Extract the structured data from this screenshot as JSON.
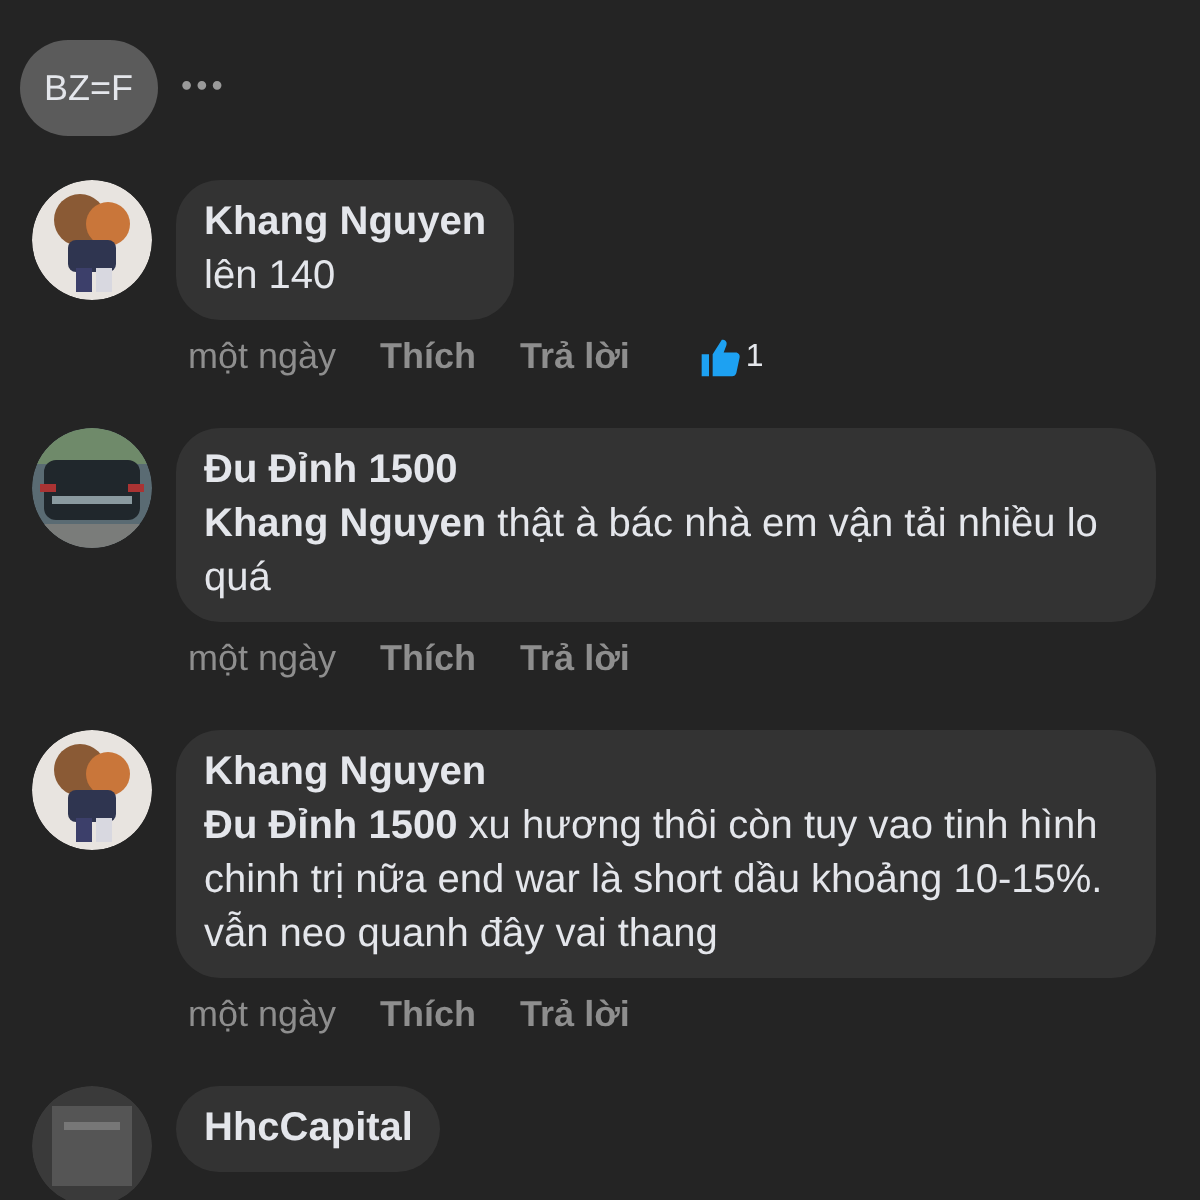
{
  "header": {
    "chip": "BZ=F",
    "more": "•••"
  },
  "comments": [
    {
      "author": "Khang Nguyen",
      "text": "lên 140",
      "time": "một ngày",
      "like": "Thích",
      "reply": "Trả lời",
      "reactions": "1"
    },
    {
      "author": "Đu Đỉnh 1500",
      "text": "**Khang Nguyen**  thật à bác nhà em vận tải nhiều lo quá",
      "time": "một ngày",
      "like": "Thích",
      "reply": "Trả lời"
    },
    {
      "author": "Khang Nguyen",
      "text": "**Đu Đỉnh 1500**  xu hương thôi còn tuy vao tinh hình chinh trị nữa end war là short dầu khoảng 10-15%. vẫn neo quanh đây vai thang",
      "time": "một ngày",
      "like": "Thích",
      "reply": "Trả lời"
    },
    {
      "author": "HhcCapital"
    }
  ]
}
